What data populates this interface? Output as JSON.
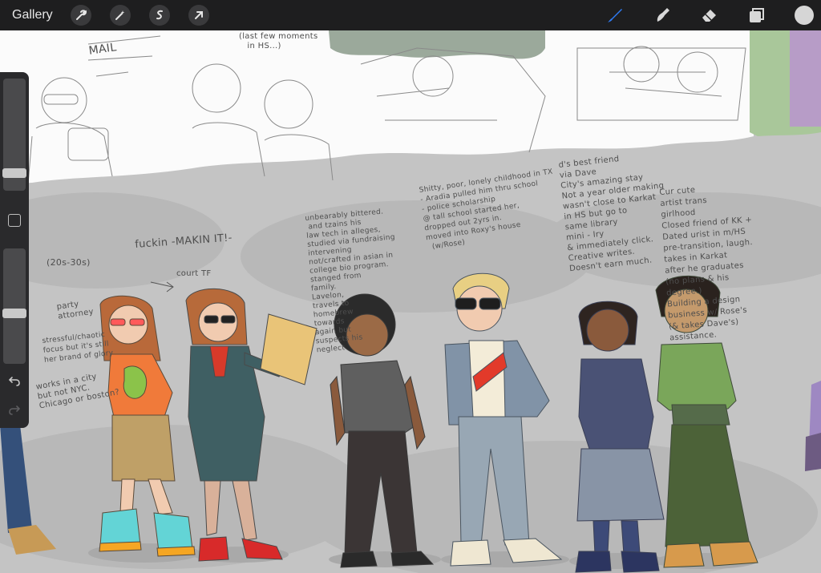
{
  "toolbar": {
    "gallery_label": "Gallery",
    "left_tools": [
      "wrench-icon",
      "magic-wand-icon",
      "selection-icon",
      "transform-arrow-icon"
    ],
    "right_tools": [
      "brush-icon",
      "smudge-icon",
      "eraser-icon",
      "layers-icon"
    ],
    "brush_active_color": "#2f7cf6",
    "current_color": "#d6d6d6"
  },
  "sidebar": {
    "size_slider_level": 0.2,
    "opacity_slider_level": 0.45,
    "buttons": [
      "modify-button",
      "undo-icon",
      "redo-icon"
    ]
  },
  "notes": {
    "mail": "MAIL",
    "last_few": "(last few moments\n   in HS...)",
    "twenties": "(20s-30s)",
    "makin_it": "fuckin -MAKIN IT!-",
    "court_tf": "court TF",
    "party": "party\nattorney",
    "works_in": "works in a city\nbut not NYC.\nChicago or boston?",
    "roxy_note": "stressful/chaotic\nfocus but it's still\nher brand of glory",
    "dave_note": "unbearably bittered.\n and tzains his\nlaw tech in alleges,\nstudied via fundraising\nintervening\nnot/crafted in asian in\ncollege bio program.\nstanged from\nfamily.\nLavelon,\ntravels to\nhomebrew\ntowards\nagain but\nsuspects his\nneglect",
    "karkat_note": "Shitty, poor, lonely childhood in TX\n- Aradia pulled him thru school\n- police scholarship\n@ tall school started her,\ndropped out 2yrs in.\nmoved into Roxy's house\n  (w/Rose)",
    "jade_note": "d's best friend\nvia Dave\nCity's amazing stay\nNot a year older making\nwasn't close to Karkat\nin HS but go to\nsame library\nmini - Iry\n& immediately click.\nCreative writes.\nDoesn't earn much.",
    "terezi_note": "Cur cute\nartist trans\ngirlhood\nClosed friend of KK +\nDated urist in m/HS\npre-transition, laugh.\ntakes in Karkat\nafter he graduates\n(no plans & his\ndegree.)\nBuilding a design\nbusiness w/ Rose's\n(& takes Dave's)\nassistance."
  }
}
